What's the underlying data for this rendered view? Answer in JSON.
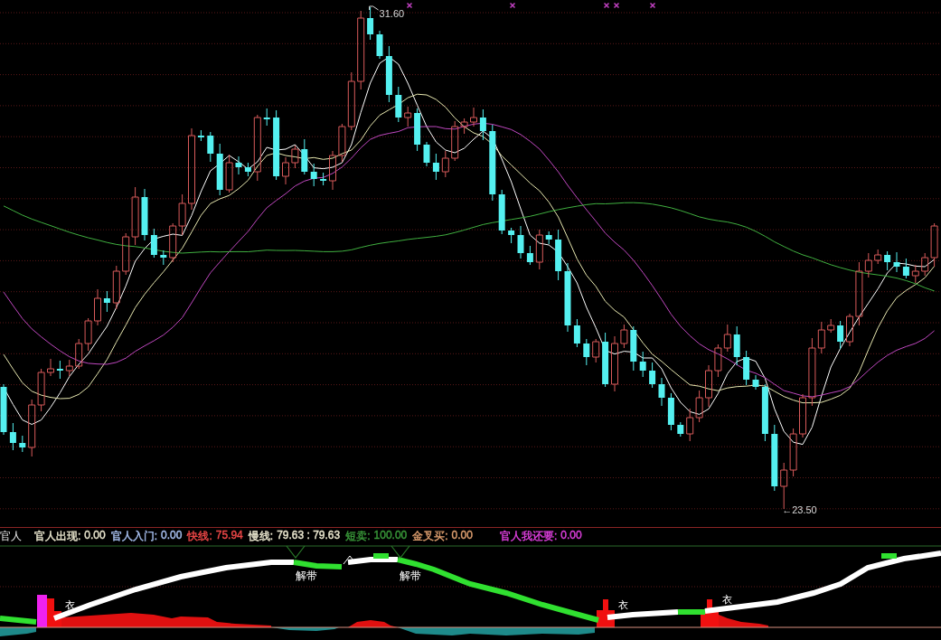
{
  "price_chart": {
    "high_label": "31.60",
    "low_label": "←23.50"
  },
  "indicator_bar": {
    "title": "官人",
    "readings": [
      {
        "label": "官人出现:",
        "value": "0.00",
        "color": "#ece8d0"
      },
      {
        "label": "官人入门:",
        "value": "0.00",
        "color": "#a8c0f0"
      },
      {
        "label": "快线:",
        "value": "75.94",
        "color": "#f04848"
      },
      {
        "label": "慢线:",
        "value": "79.63 : 79.63",
        "color": "#ece8d0"
      },
      {
        "label": "短卖:",
        "value": "100.00",
        "color": "#3a9a3a"
      },
      {
        "label": "金叉买:",
        "value": "0.00",
        "color": "#e0a070"
      },
      {
        "label": "官人我还要:",
        "value": "0.00",
        "color": "#e040e0"
      }
    ]
  },
  "indicator_chart": {
    "band_labels": [
      "解带",
      "解带"
    ],
    "signal_labels": [
      "衣",
      "衣",
      "衣"
    ]
  }
}
